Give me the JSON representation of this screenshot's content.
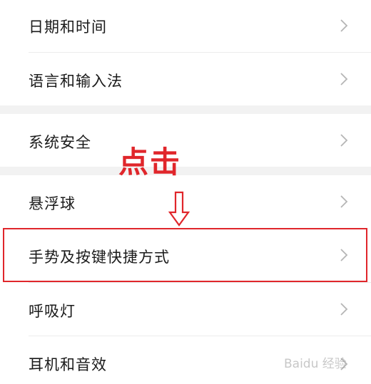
{
  "settings_list": {
    "items": [
      {
        "label": "日期和时间"
      },
      {
        "label": "语言和输入法"
      },
      {
        "label": "系统安全"
      },
      {
        "label": "悬浮球"
      },
      {
        "label": "手势及按键快捷方式"
      },
      {
        "label": "呼吸灯"
      },
      {
        "label": "耳机和音效"
      }
    ]
  },
  "annotation": {
    "text": "点击",
    "color": "#e0262b"
  },
  "watermark": {
    "text": "Baidu 经验"
  },
  "icons": {
    "chevron": "chevron-right-icon",
    "arrow": "down-arrow-icon"
  },
  "colors": {
    "highlight": "#e0262b",
    "section_gap": "#f2f2f2",
    "chevron": "#b5b5b5"
  }
}
